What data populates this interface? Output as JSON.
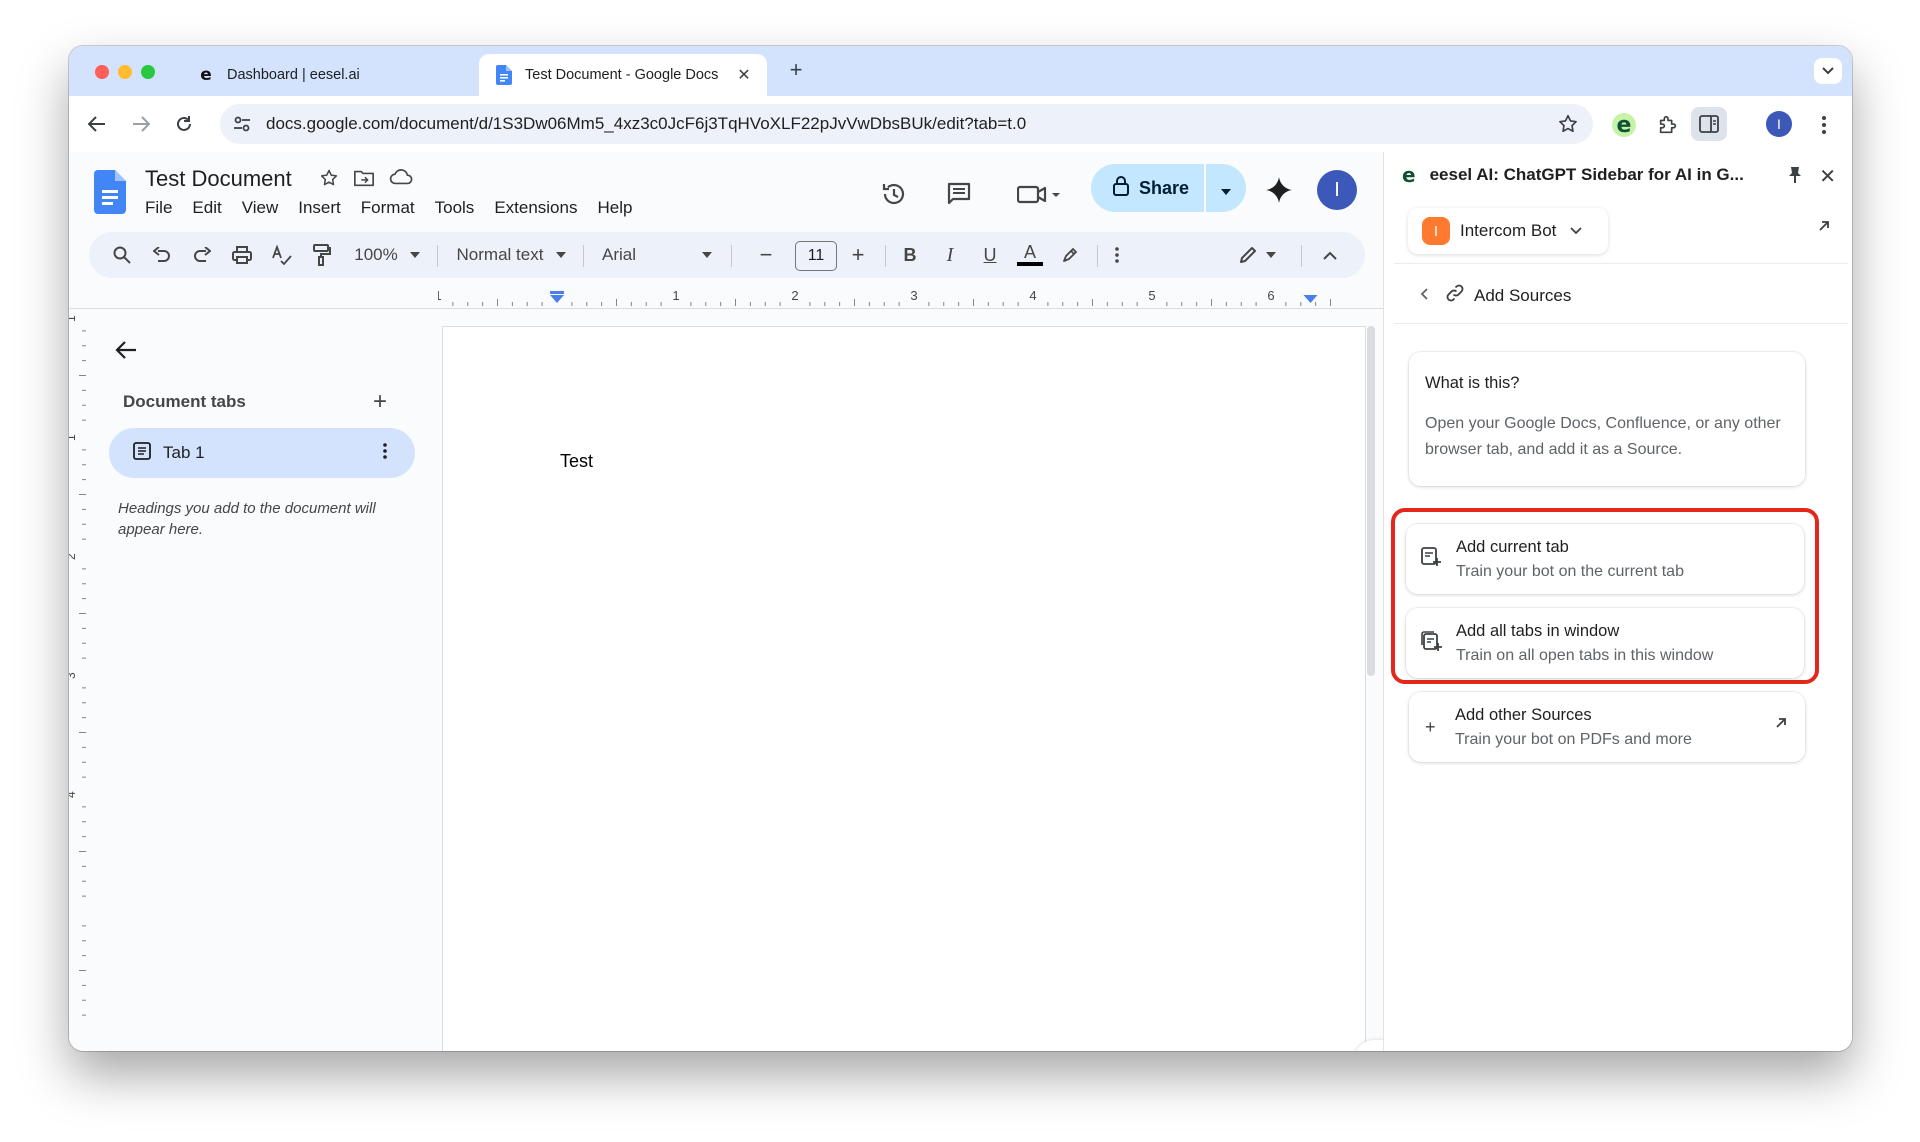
{
  "browser": {
    "tabs": [
      {
        "title": "Dashboard | eesel.ai",
        "favicon": "eesel-logo",
        "active": false
      },
      {
        "title": "Test Document - Google Docs",
        "favicon": "google-docs-icon",
        "active": true
      }
    ],
    "url": "docs.google.com/document/d/1S3Dw06Mm5_4xz3c0JcF6j3TqHVoXLF22pJvVwDbsBUk/edit?tab=t.0",
    "profile_initial": "I"
  },
  "docs": {
    "title": "Test Document",
    "menu": [
      "File",
      "Edit",
      "View",
      "Insert",
      "Format",
      "Tools",
      "Extensions",
      "Help"
    ],
    "share_label": "Share",
    "avatar_initial": "I",
    "toolbar": {
      "zoom": "100%",
      "style": "Normal text",
      "font": "Arial",
      "font_size": "11",
      "bold": "B",
      "italic": "I",
      "underline": "U",
      "text_color": "A"
    },
    "ruler_numbers": [
      "1",
      "1",
      "2",
      "3",
      "4",
      "5",
      "6"
    ],
    "vruler_numbers": [
      "1",
      "1",
      "2",
      "3",
      "4"
    ],
    "outline": {
      "title": "Document tabs",
      "tab_label": "Tab 1",
      "hint": "Headings you add to the document will appear here."
    },
    "body_text": "Test"
  },
  "panel": {
    "title": "eesel AI: ChatGPT Sidebar for AI in G...",
    "bot_initial": "I",
    "bot_name": "Intercom Bot",
    "breadcrumb": "Add Sources",
    "info_title": "What is this?",
    "info_body": "Open your Google Docs, Confluence, or any other browser tab, and add it as a Source.",
    "options": [
      {
        "title": "Add current tab",
        "subtitle": "Train your bot on the current tab"
      },
      {
        "title": "Add all tabs in window",
        "subtitle": "Train on all open tabs in this window"
      },
      {
        "title": "Add other Sources",
        "subtitle": "Train your bot on PDFs and more"
      }
    ],
    "highlight_color": "#e5261b"
  },
  "colors": {
    "tabstrip": "#d3e3fd",
    "share_button": "#c2e7ff",
    "bot_avatar": "#ff7a2e",
    "profile": "#3c58b8"
  }
}
